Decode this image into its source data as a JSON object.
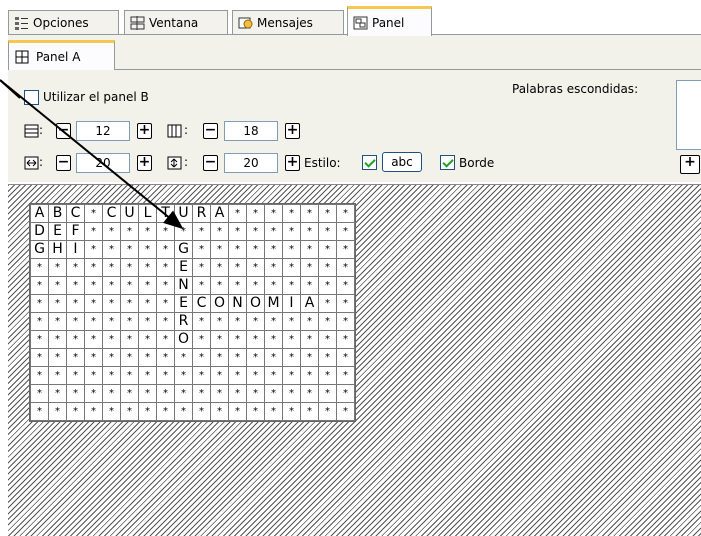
{
  "top_tabs": [
    {
      "label": "Opciones",
      "icon": "options-icon",
      "active": false
    },
    {
      "label": "Ventana",
      "icon": "window-icon",
      "active": false
    },
    {
      "label": "Mensajes",
      "icon": "messages-icon",
      "active": false
    },
    {
      "label": "Panel",
      "icon": "panel-icon",
      "active": true
    }
  ],
  "sub_tab": {
    "label": "Panel A",
    "icon": "grid-icon"
  },
  "options": {
    "use_panel_b_label": "Utilizar el panel B",
    "use_panel_b_checked": false,
    "hidden_words_label": "Palabras escondidas:"
  },
  "rows_field": {
    "sep": ":",
    "value": "12"
  },
  "cols_field": {
    "sep": ":",
    "value": "18"
  },
  "width_field": {
    "sep": ":",
    "value": "20"
  },
  "height_field": {
    "sep": ":",
    "value": "20"
  },
  "style": {
    "label": "Estilo:",
    "abc_label": "abc",
    "abc_checked": true,
    "border_label": "Borde",
    "border_checked": true
  },
  "grid": [
    [
      "A",
      "B",
      "C",
      "*",
      "C",
      "U",
      "L",
      "T",
      "U",
      "R",
      "A",
      "*",
      "*",
      "*",
      "*",
      "*",
      "*",
      "*"
    ],
    [
      "D",
      "E",
      "F",
      "*",
      "*",
      "*",
      "*",
      "*",
      "*",
      "*",
      "*",
      "*",
      "*",
      "*",
      "*",
      "*",
      "*",
      "*"
    ],
    [
      "G",
      "H",
      "I",
      "*",
      "*",
      "*",
      "*",
      "*",
      "G",
      "*",
      "*",
      "*",
      "*",
      "*",
      "*",
      "*",
      "*",
      "*"
    ],
    [
      "*",
      "*",
      "*",
      "*",
      "*",
      "*",
      "*",
      "*",
      "E",
      "*",
      "*",
      "*",
      "*",
      "*",
      "*",
      "*",
      "*",
      "*"
    ],
    [
      "*",
      "*",
      "*",
      "*",
      "*",
      "*",
      "*",
      "*",
      "N",
      "*",
      "*",
      "*",
      "*",
      "*",
      "*",
      "*",
      "*",
      "*"
    ],
    [
      "*",
      "*",
      "*",
      "*",
      "*",
      "*",
      "*",
      "*",
      "E",
      "C",
      "O",
      "N",
      "O",
      "M",
      "I",
      "A",
      "*",
      "*"
    ],
    [
      "*",
      "*",
      "*",
      "*",
      "*",
      "*",
      "*",
      "*",
      "R",
      "*",
      "*",
      "*",
      "*",
      "*",
      "*",
      "*",
      "*",
      "*"
    ],
    [
      "*",
      "*",
      "*",
      "*",
      "*",
      "*",
      "*",
      "*",
      "O",
      "*",
      "*",
      "*",
      "*",
      "*",
      "*",
      "*",
      "*",
      "*"
    ],
    [
      "*",
      "*",
      "*",
      "*",
      "*",
      "*",
      "*",
      "*",
      "*",
      "*",
      "*",
      "*",
      "*",
      "*",
      "*",
      "*",
      "*",
      "*"
    ],
    [
      "*",
      "*",
      "*",
      "*",
      "*",
      "*",
      "*",
      "*",
      "*",
      "*",
      "*",
      "*",
      "*",
      "*",
      "*",
      "*",
      "*",
      "*"
    ],
    [
      "*",
      "*",
      "*",
      "*",
      "*",
      "*",
      "*",
      "*",
      "*",
      "*",
      "*",
      "*",
      "*",
      "*",
      "*",
      "*",
      "*",
      "*"
    ],
    [
      "*",
      "*",
      "*",
      "*",
      "*",
      "*",
      "*",
      "*",
      "*",
      "*",
      "*",
      "*",
      "*",
      "*",
      "*",
      "*",
      "*",
      "*"
    ]
  ],
  "colors": {
    "accent_tab": "#f7c84f",
    "check_green": "#21a121",
    "panel_bg": "#f3f2ea"
  }
}
